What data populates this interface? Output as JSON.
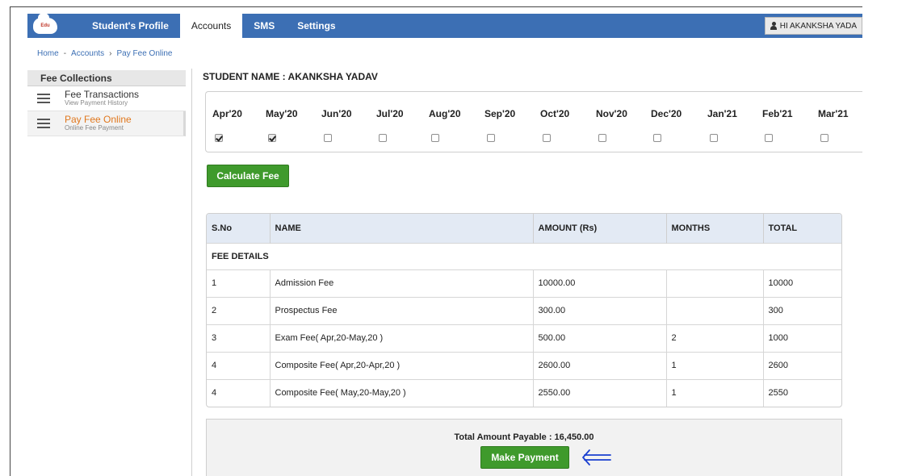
{
  "navbar": {
    "logo_text": "Edu",
    "items": [
      {
        "label": "Student's Profile"
      },
      {
        "label": "Accounts"
      },
      {
        "label": "SMS"
      },
      {
        "label": "Settings"
      }
    ],
    "user_label": "HI AKANKSHA YADA"
  },
  "breadcrumb": {
    "home": "Home",
    "sep1": "-",
    "accounts": "Accounts",
    "sep2": "›",
    "current": "Pay Fee Online"
  },
  "sidebar": {
    "title": "Fee Collections",
    "items": [
      {
        "title": "Fee Transactions",
        "subtitle": "View Payment History"
      },
      {
        "title": "Pay Fee Online",
        "subtitle": "Online Fee Payment"
      }
    ]
  },
  "student_name": "STUDENT NAME : AKANKSHA YADAV",
  "months": [
    {
      "label": "Apr'20",
      "checked": true
    },
    {
      "label": "May'20",
      "checked": true
    },
    {
      "label": "Jun'20",
      "checked": false
    },
    {
      "label": "Jul'20",
      "checked": false
    },
    {
      "label": "Aug'20",
      "checked": false
    },
    {
      "label": "Sep'20",
      "checked": false
    },
    {
      "label": "Oct'20",
      "checked": false
    },
    {
      "label": "Nov'20",
      "checked": false
    },
    {
      "label": "Dec'20",
      "checked": false
    },
    {
      "label": "Jan'21",
      "checked": false
    },
    {
      "label": "Feb'21",
      "checked": false
    },
    {
      "label": "Mar'21",
      "checked": false
    }
  ],
  "calculate_label": "Calculate Fee",
  "fee_table": {
    "headers": [
      "S.No",
      "NAME",
      "AMOUNT (Rs)",
      "MONTHS",
      "TOTAL"
    ],
    "section_label": "FEE DETAILS",
    "rows": [
      [
        "1",
        "Admission Fee",
        "10000.00",
        "",
        "10000"
      ],
      [
        "2",
        "Prospectus Fee",
        "300.00",
        "",
        "300"
      ],
      [
        "3",
        "Exam Fee( Apr,20-May,20 )",
        "500.00",
        "2",
        "1000"
      ],
      [
        "4",
        "Composite Fee( Apr,20-Apr,20 )",
        "2600.00",
        "1",
        "2600"
      ],
      [
        "4",
        "Composite Fee( May,20-May,20 )",
        "2550.00",
        "1",
        "2550"
      ]
    ]
  },
  "total_label": "Total Amount Payable : 16,450.00",
  "make_payment_label": "Make Payment",
  "colors": {
    "navbar": "#3c6fb4",
    "button_green": "#3f9a2c",
    "active_side": "#e0771d",
    "annotation_arrow": "#1a3fd0"
  }
}
